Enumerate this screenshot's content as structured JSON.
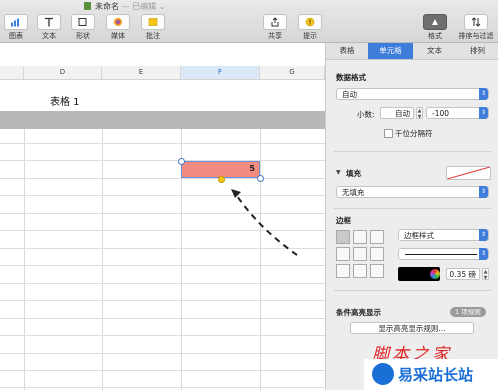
{
  "window": {
    "title": "未命名",
    "subtitle": "— 已编辑 ⌄"
  },
  "toolbar": {
    "items": [
      {
        "label": "图表",
        "icon": "chart-icon"
      },
      {
        "label": "文本",
        "icon": "text-icon"
      },
      {
        "label": "形状",
        "icon": "shape-icon"
      },
      {
        "label": "媒体",
        "icon": "media-icon"
      },
      {
        "label": "批注",
        "icon": "comment-icon"
      },
      {
        "label": "共享",
        "icon": "share-icon"
      },
      {
        "label": "提示",
        "icon": "tips-icon"
      },
      {
        "label": "格式",
        "icon": "format-brush-icon"
      },
      {
        "label": "排序与过滤",
        "icon": "sort-icon"
      }
    ]
  },
  "sheet": {
    "title": "表格 1",
    "columns": [
      "D",
      "E",
      "F",
      "G"
    ],
    "selected_column": "F",
    "selected_cell_value": "5",
    "selected_cell_color": "#f28b80"
  },
  "sidebar": {
    "tabs": [
      "表格",
      "单元格",
      "文本",
      "排列"
    ],
    "active_tab": "单元格",
    "data_format": {
      "label": "数据格式",
      "value": "自动",
      "decimals_label": "小数:",
      "decimals_value": "自动",
      "negative_value": "-100",
      "thousands_label": "千位分隔符"
    },
    "fill": {
      "label": "填充",
      "value": "无填充"
    },
    "border": {
      "label": "边框",
      "style_value": "边框样式",
      "width_value": "0.35 磅",
      "color": "#000000"
    },
    "conditional": {
      "label": "条件高亮显示",
      "badge": "1 项规则",
      "button": "显示高亮显示规则..."
    }
  },
  "watermark": {
    "line1": "脚本之家",
    "line2": "易采站长站"
  }
}
